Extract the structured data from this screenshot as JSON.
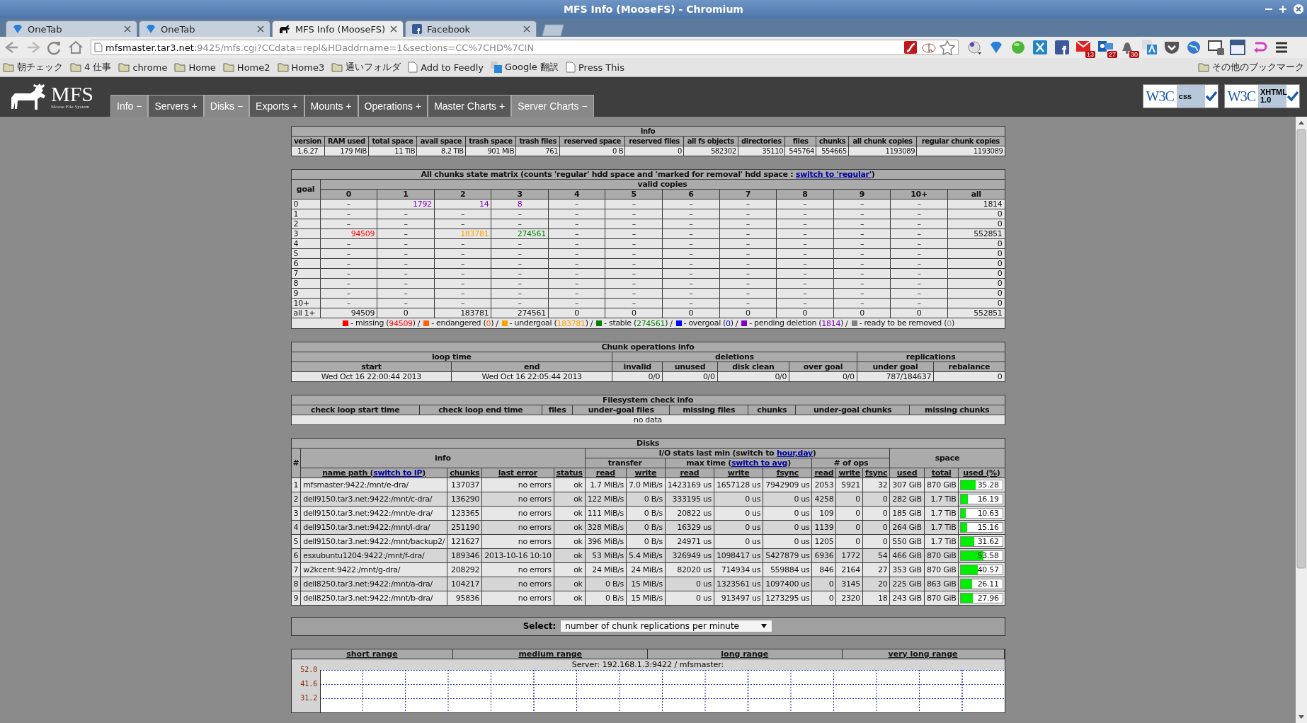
{
  "window": {
    "title": "MFS Info (MooseFS) - Chromium"
  },
  "tabs": [
    {
      "title": "OneTab",
      "kind": "gem",
      "selected": false
    },
    {
      "title": "OneTab",
      "kind": "gem",
      "selected": false
    },
    {
      "title": "MFS Info (MooseFS)",
      "kind": "moose",
      "selected": true
    },
    {
      "title": "Facebook",
      "kind": "square",
      "selected": false
    }
  ],
  "address": {
    "host": "mfsmaster.tar3.net",
    "rest": ":9425/mfs.cgi?CCdata=repl&HDaddrname=1&sections=CC%7CHD%7CIN"
  },
  "extensions": [
    {
      "kind": "dial"
    },
    {
      "kind": "gem"
    },
    {
      "kind": "ball"
    },
    {
      "kind": "cross"
    },
    {
      "kind": "square"
    },
    {
      "kind": "mail",
      "badge": "13"
    },
    {
      "kind": "envelope",
      "badge": "27"
    },
    {
      "kind": "bell",
      "badge": "30"
    },
    {
      "kind": "translate"
    },
    {
      "kind": "shield"
    },
    {
      "kind": "globe"
    },
    {
      "kind": "monitor"
    },
    {
      "kind": "window"
    },
    {
      "kind": "arrow"
    },
    {
      "kind": "menu"
    }
  ],
  "bookmarks": [
    {
      "label": "朝チェック",
      "kind": "folder"
    },
    {
      "label": "4 仕事",
      "kind": "folder"
    },
    {
      "label": "chrome",
      "kind": "folder"
    },
    {
      "label": "Home",
      "kind": "folder"
    },
    {
      "label": "Home2",
      "kind": "folder"
    },
    {
      "label": "Home3",
      "kind": "folder"
    },
    {
      "label": "通いフォルダ",
      "kind": "folder"
    },
    {
      "label": "Add to Feedly",
      "kind": "page"
    },
    {
      "label": "Google 翻訳",
      "kind": "translate"
    },
    {
      "label": "Press This",
      "kind": "page"
    }
  ],
  "other_bookmarks": "その他のブックマーク",
  "logo": {
    "text": "MFS",
    "subtitle": "Moose File System"
  },
  "menu": [
    {
      "label": "Info",
      "sign": "−",
      "expanded": true
    },
    {
      "label": "Servers",
      "sign": "+",
      "expanded": false
    },
    {
      "label": "Disks",
      "sign": "−",
      "expanded": true
    },
    {
      "label": "Exports",
      "sign": "+",
      "expanded": false
    },
    {
      "label": "Mounts",
      "sign": "+",
      "expanded": false
    },
    {
      "label": "Operations",
      "sign": "+",
      "expanded": false
    },
    {
      "label": "Master Charts",
      "sign": "+",
      "expanded": false
    },
    {
      "label": "Server Charts",
      "sign": "−",
      "expanded": true
    }
  ],
  "badges": [
    {
      "logo": "W3C",
      "label": "css"
    },
    {
      "logo": "W3C",
      "label": "XHTML 1.0"
    }
  ],
  "info": {
    "title": "Info",
    "columns": [
      "version",
      "RAM used",
      "total space",
      "avail space",
      "trash space",
      "trash files",
      "reserved space",
      "reserved files",
      "all fs objects",
      "directories",
      "files",
      "chunks",
      "all chunk copies",
      "regular chunk copies"
    ],
    "values": [
      "1.6.27",
      "179 MiB",
      "11 TiB",
      "8.2 TiB",
      "901 MiB",
      "761",
      "0 B",
      "0",
      "582302",
      "35110",
      "545764",
      "554665",
      "1193089",
      "1193089"
    ]
  },
  "matrix": {
    "title": "All chunks state matrix (counts 'regular' hdd space and 'marked for removal' hdd space : ",
    "link": "switch to 'regular'",
    "title_end": ")",
    "goal_header": "goal",
    "copies_header": "valid copies",
    "columns": [
      "0",
      "1",
      "2",
      "3",
      "4",
      "5",
      "6",
      "7",
      "8",
      "9",
      "10+",
      "all"
    ],
    "rows": [
      {
        "goal": "0",
        "cells": [
          "–",
          {
            "text": "1792",
            "color": "#8000c0"
          },
          {
            "text": "14",
            "color": "#8000c0"
          },
          {
            "text": "8",
            "color": "#8000c0"
          },
          "–",
          "–",
          "–",
          "–",
          "–",
          "–",
          "–",
          "1814"
        ]
      },
      {
        "goal": "1",
        "cells": [
          "–",
          "–",
          "–",
          "–",
          "–",
          "–",
          "–",
          "–",
          "–",
          "–",
          "–",
          "0"
        ]
      },
      {
        "goal": "2",
        "cells": [
          "–",
          "–",
          "–",
          "–",
          "–",
          "–",
          "–",
          "–",
          "–",
          "–",
          "–",
          "0"
        ]
      },
      {
        "goal": "3",
        "cells": [
          {
            "text": "94509",
            "color": "#ff0000"
          },
          "–",
          {
            "text": "183781",
            "color": "#ffa000"
          },
          {
            "text": "274561",
            "color": "#008000"
          },
          "–",
          "–",
          "–",
          "–",
          "–",
          "–",
          "–",
          "552851"
        ]
      },
      {
        "goal": "4",
        "cells": [
          "–",
          "–",
          "–",
          "–",
          "–",
          "–",
          "–",
          "–",
          "–",
          "–",
          "–",
          "0"
        ]
      },
      {
        "goal": "5",
        "cells": [
          "–",
          "–",
          "–",
          "–",
          "–",
          "–",
          "–",
          "–",
          "–",
          "–",
          "–",
          "0"
        ]
      },
      {
        "goal": "6",
        "cells": [
          "–",
          "–",
          "–",
          "–",
          "–",
          "–",
          "–",
          "–",
          "–",
          "–",
          "–",
          "0"
        ]
      },
      {
        "goal": "7",
        "cells": [
          "–",
          "–",
          "–",
          "–",
          "–",
          "–",
          "–",
          "–",
          "–",
          "–",
          "–",
          "0"
        ]
      },
      {
        "goal": "8",
        "cells": [
          "–",
          "–",
          "–",
          "–",
          "–",
          "–",
          "–",
          "–",
          "–",
          "–",
          "–",
          "0"
        ]
      },
      {
        "goal": "9",
        "cells": [
          "–",
          "–",
          "–",
          "–",
          "–",
          "–",
          "–",
          "–",
          "–",
          "–",
          "–",
          "0"
        ]
      },
      {
        "goal": "10+",
        "cells": [
          "–",
          "–",
          "–",
          "–",
          "–",
          "–",
          "–",
          "–",
          "–",
          "–",
          "–",
          "0"
        ]
      },
      {
        "goal": "all 1+",
        "cells": [
          "94509",
          "0",
          "183781",
          "274561",
          "0",
          "0",
          "0",
          "0",
          "0",
          "0",
          "0",
          "552851"
        ]
      }
    ],
    "legend_separator": "/",
    "legend": [
      {
        "color": "#ff0000",
        "label": "- missing (",
        "count": "94509",
        "end": ")"
      },
      {
        "color": "#ff6000",
        "label": "- endangered (",
        "count": "0",
        "end": ")"
      },
      {
        "color": "#ffa000",
        "label": "- undergoal (",
        "count": "183781",
        "end": ")"
      },
      {
        "color": "#008000",
        "label": "- stable (",
        "count": "274561",
        "end": ")"
      },
      {
        "color": "#0000ff",
        "label": "- overgoal (",
        "count": "0",
        "end": ")"
      },
      {
        "color": "#8000c0",
        "label": "- pending deletion (",
        "count": "1814",
        "end": ")"
      },
      {
        "color": "#808080",
        "label": "- ready to be removed (",
        "count": "0",
        "end": ")"
      }
    ]
  },
  "chunk_ops": {
    "title": "Chunk operations info",
    "groups": [
      {
        "label": "loop time"
      },
      {
        "label": "deletions"
      },
      {
        "label": "replications"
      }
    ],
    "columns": [
      "start",
      "end",
      "invalid",
      "unused",
      "disk clean",
      "over goal",
      "under goal",
      "rebalance"
    ],
    "values": [
      "Wed Oct 16 22:00:44 2013",
      "Wed Oct 16 22:05:44 2013",
      "0/0",
      "0/0",
      "0/0",
      "0/0",
      "787/184637",
      "0"
    ]
  },
  "fs_check": {
    "title": "Filesystem check info",
    "columns": [
      "check loop start time",
      "check loop end time",
      "files",
      "under-goal files",
      "missing files",
      "chunks",
      "under-goal chunks",
      "missing chunks"
    ],
    "message": "no data"
  },
  "disks": {
    "title": "Disks",
    "hash": "#",
    "info_header": "info",
    "io_header": "I/O stats last min (switch to ",
    "io_link": "hour,day",
    "io_end": ")",
    "space_header": "space",
    "transfer_header": "transfer",
    "max_time_header": "max time (",
    "max_time_link": "switch to avg",
    "max_time_end": ")",
    "ops_header": "# of ops",
    "path_header": "name path (",
    "path_link": "switch to IP",
    "path_end": ")",
    "columns": [
      "chunks",
      "last error",
      "status",
      "read",
      "write",
      "read",
      "write",
      "fsync",
      "read",
      "write",
      "fsync",
      "used",
      "total",
      "used (%)"
    ],
    "rows": [
      {
        "num": "1",
        "path": "mfsmaster:9422:/mnt/e-dra/",
        "cells": [
          "137037",
          "no errors",
          "ok",
          "1.7 MiB/s",
          "7.0 MiB/s",
          "1423169 us",
          "1657128 us",
          "7942909 us",
          "2053",
          "5921",
          "32",
          "307 GiB",
          "870 GiB"
        ],
        "level": 0.3528,
        "percent": "35.28"
      },
      {
        "num": "2",
        "path": "dell9150.tar3.net:9422:/mnt/c-dra/",
        "cells": [
          "136290",
          "no errors",
          "ok",
          "122 MiB/s",
          "0 B/s",
          "333195 us",
          "0 us",
          "0 us",
          "4258",
          "0",
          "0",
          "282 GiB",
          "1.7 TiB"
        ],
        "level": 0.1619,
        "percent": "16.19"
      },
      {
        "num": "3",
        "path": "dell9150.tar3.net:9422:/mnt/e-dra/",
        "cells": [
          "123365",
          "no errors",
          "ok",
          "111 MiB/s",
          "0 B/s",
          "20822 us",
          "0 us",
          "0 us",
          "109",
          "0",
          "0",
          "185 GiB",
          "1.7 TiB"
        ],
        "level": 0.1063,
        "percent": "10.63"
      },
      {
        "num": "4",
        "path": "dell9150.tar3.net:9422:/mnt/i-dra/",
        "cells": [
          "251190",
          "no errors",
          "ok",
          "328 MiB/s",
          "0 B/s",
          "16329 us",
          "0 us",
          "0 us",
          "1139",
          "0",
          "0",
          "264 GiB",
          "1.7 TiB"
        ],
        "level": 0.1516,
        "percent": "15.16"
      },
      {
        "num": "5",
        "path": "dell9150.tar3.net:9422:/mnt/backup2/",
        "cells": [
          "121627",
          "no errors",
          "ok",
          "396 MiB/s",
          "0 B/s",
          "24971 us",
          "0 us",
          "0 us",
          "1205",
          "0",
          "0",
          "550 GiB",
          "1.7 TiB"
        ],
        "level": 0.3162,
        "percent": "31.62"
      },
      {
        "num": "6",
        "path": "esxubuntu1204:9422:/mnt/f-dra/",
        "cells": [
          "189346",
          "2013-10-16 10:10",
          "ok",
          "53 MiB/s",
          "5.4 MiB/s",
          "326949 us",
          "1098417 us",
          "5427879 us",
          "6936",
          "1772",
          "54",
          "466 GiB",
          "870 GiB"
        ],
        "level": 0.5358,
        "percent": "53.58"
      },
      {
        "num": "7",
        "path": "w2kcent:9422:/mnt/g-dra/",
        "cells": [
          "208292",
          "no errors",
          "ok",
          "24 MiB/s",
          "24 MiB/s",
          "82020 us",
          "714934 us",
          "559884 us",
          "846",
          "2164",
          "27",
          "353 GiB",
          "870 GiB"
        ],
        "level": 0.4057,
        "percent": "40.57"
      },
      {
        "num": "8",
        "path": "dell8250.tar3.net:9422:/mnt/a-dra/",
        "cells": [
          "104217",
          "no errors",
          "ok",
          "0 B/s",
          "15 MiB/s",
          "0 us",
          "1323561 us",
          "1097400 us",
          "0",
          "3145",
          "20",
          "225 GiB",
          "863 GiB"
        ],
        "level": 0.2611,
        "percent": "26.11"
      },
      {
        "num": "9",
        "path": "dell8250.tar3.net:9422:/mnt/b-dra/",
        "cells": [
          "95836",
          "no errors",
          "ok",
          "0 B/s",
          "15 MiB/s",
          "0 us",
          "913497 us",
          "1273295 us",
          "0",
          "2320",
          "18",
          "243 GiB",
          "870 GiB"
        ],
        "level": 0.2796,
        "percent": "27.96"
      }
    ]
  },
  "select": {
    "label": "Select:",
    "value": "number of chunk replications per minute"
  },
  "charts": {
    "ranges": [
      "short range",
      "medium range",
      "long range",
      "very long range"
    ],
    "server": "Server: 192.168.1.3:9422 / mfsmaster:",
    "y_ticks": [
      "52.0",
      "41.6",
      "31.2"
    ]
  }
}
